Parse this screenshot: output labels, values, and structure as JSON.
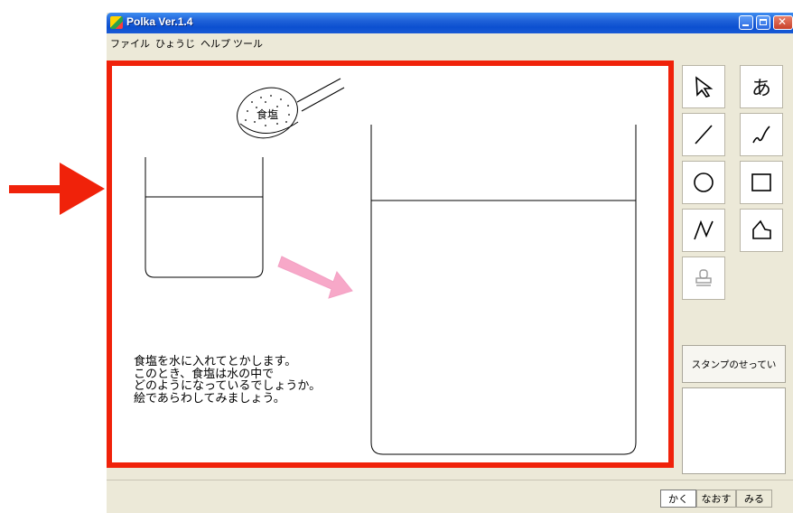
{
  "window": {
    "title": "Polka Ver.1.4"
  },
  "menu": [
    "ファイル",
    "ひょうじ",
    "ヘルプ",
    "ツール"
  ],
  "canvas": {
    "salt_label": "食塩",
    "instructions": [
      "食塩を水に入れてとかします。",
      "このとき、食塩は水の中で",
      "どのようになっているでしょうか。",
      "絵であらわしてみましょう。"
    ]
  },
  "tools": {
    "items": [
      "select-arrow",
      "text",
      "line",
      "freehand",
      "circle",
      "rectangle",
      "polyline",
      "polygon",
      "stamp"
    ],
    "text_tool_label": "あ",
    "stamp_settings_label": "スタンプのせってい"
  },
  "modes": {
    "draw": "かく",
    "fix": "なおす",
    "view": "みる",
    "selected": "かく"
  },
  "colors": {
    "highlight_frame": "#f0220a",
    "annotation_arrow": "#f0220a",
    "pink_arrow": "#f7a8c8"
  }
}
